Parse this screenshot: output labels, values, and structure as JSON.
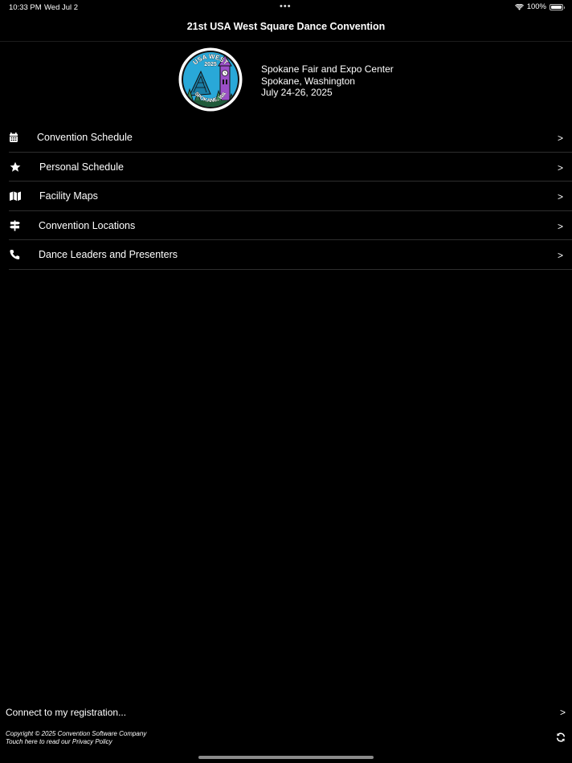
{
  "status_bar": {
    "time": "10:33 PM",
    "date": "Wed Jul 2",
    "battery": "100%",
    "icons": [
      "wifi-icon",
      "battery-icon"
    ]
  },
  "header": {
    "title": "21st USA West Square Dance Convention"
  },
  "logo": {
    "text_top": "USA WEST",
    "year": "2025",
    "text_bottom": "SPOKANE, WA",
    "colors": {
      "ring": "#ffffff",
      "sky": "#29a8d8",
      "tower": "#9b4fc8",
      "trees": "#3d8a5a",
      "outline": "#111111"
    }
  },
  "event": {
    "venue": "Spokane Fair and Expo Center",
    "city": "Spokane, Washington",
    "dates": "July 24-26, 2025"
  },
  "menu": {
    "items": [
      {
        "label": "Convention Schedule",
        "icon": "calendar-icon",
        "chevron": ">"
      },
      {
        "label": "Personal Schedule",
        "icon": "star-icon",
        "chevron": ">"
      },
      {
        "label": "Facility Maps",
        "icon": "map-icon",
        "chevron": ">"
      },
      {
        "label": "Convention Locations",
        "icon": "signpost-icon",
        "chevron": ">"
      },
      {
        "label": "Dance Leaders and Presenters",
        "icon": "phone-icon",
        "chevron": ">"
      }
    ]
  },
  "connect": {
    "label": "Connect to my registration...",
    "chevron": ">"
  },
  "footer": {
    "copyright": "Copyright © 2025 Convention Software Company",
    "privacy": "Touch here to read our Privacy Policy",
    "refresh_icon": "refresh-icon"
  }
}
